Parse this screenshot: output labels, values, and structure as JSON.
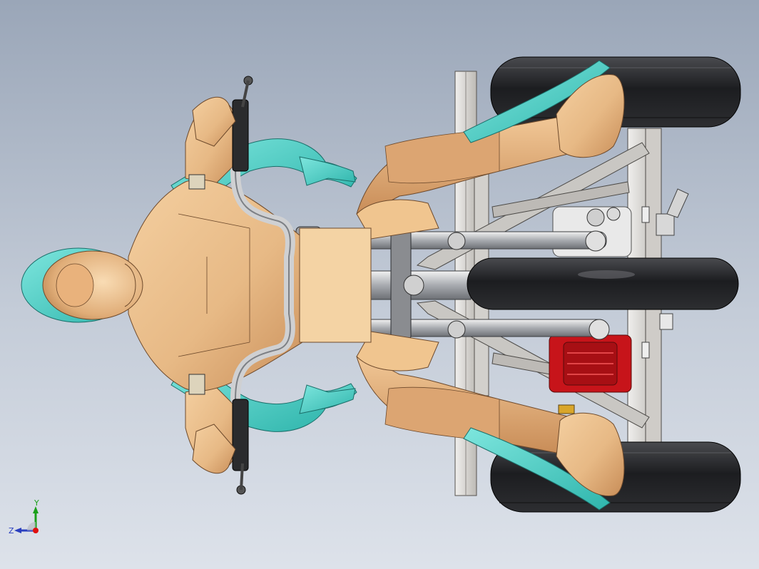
{
  "viewport": {
    "background_top": "#9aa6b8",
    "background_bottom": "#dde2ea"
  },
  "model": {
    "skin_color": "#e7b985",
    "skin_shadow_color": "#3fbfb6",
    "tire_color": "#1e1f21",
    "frame_color": "#d8d6d2",
    "engine_color": "#c7141a"
  },
  "triad": {
    "y_label": "Y",
    "z_label": "Z",
    "y_axis_color": "#1aa01a",
    "z_axis_color": "#2a3fbf",
    "origin_color": "#e01010"
  }
}
